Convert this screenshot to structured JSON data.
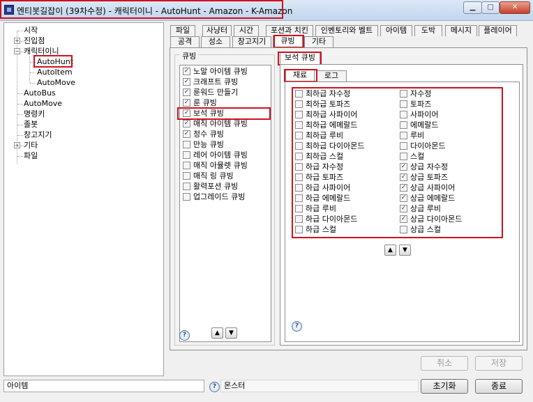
{
  "window": {
    "title": "엔티봇길잡이 (39차수정) - 캐릭터이니 - AutoHunt - Amazon - K-Amazon",
    "min_glyph": "▁",
    "max_glyph": "□",
    "close_glyph": "✕"
  },
  "tree": {
    "items": [
      {
        "label": "시작",
        "expander": ""
      },
      {
        "label": "진입점",
        "expander": "+"
      },
      {
        "label": "캐릭터이니",
        "expander": "−"
      },
      {
        "label": "AutoHunt",
        "expander": ""
      },
      {
        "label": "AutoItem",
        "expander": ""
      },
      {
        "label": "AutoMove",
        "expander": ""
      },
      {
        "label": "AutoBus",
        "expander": ""
      },
      {
        "label": "AutoMove",
        "expander": ""
      },
      {
        "label": "명령키",
        "expander": ""
      },
      {
        "label": "졸봇",
        "expander": ""
      },
      {
        "label": "창고지기",
        "expander": ""
      },
      {
        "label": "기타",
        "expander": "+"
      },
      {
        "label": "파일",
        "expander": ""
      }
    ]
  },
  "tabs": {
    "row1": [
      "파일",
      "사냥터",
      "시간",
      "포션과 치킨",
      "인벤토리와 벨트",
      "아이템",
      "도박",
      "메시지",
      "플레이어"
    ],
    "row2": [
      "공격",
      "성소",
      "창고지기",
      "큐빙",
      "기타"
    ],
    "active": "큐빙"
  },
  "cubing": {
    "group_title": "큐빙",
    "items": [
      {
        "label": "노말 아이템 큐빙",
        "checked": true
      },
      {
        "label": "크래프트 큐빙",
        "checked": true
      },
      {
        "label": "룬워드 만들기",
        "checked": true
      },
      {
        "label": "룬 큐빙",
        "checked": true
      },
      {
        "label": "보석 큐빙",
        "checked": true
      },
      {
        "label": "매직 아이템 큐빙",
        "checked": true
      },
      {
        "label": "정수 큐빙",
        "checked": true
      },
      {
        "label": "만능 큐빙",
        "checked": false
      },
      {
        "label": "레어 아이템 큐빙",
        "checked": false
      },
      {
        "label": "매직 아뮬렛 큐빙",
        "checked": false
      },
      {
        "label": "매직 링 큐빙",
        "checked": false
      },
      {
        "label": "활력포션 큐빙",
        "checked": false
      },
      {
        "label": "업그레이드 큐빙",
        "checked": false
      }
    ]
  },
  "gem_tab": {
    "title": "보석 큐빙",
    "subtabs": [
      "재료",
      "로그"
    ],
    "active_subtab": "재료",
    "col1": [
      {
        "label": "최하급 자수정",
        "checked": false
      },
      {
        "label": "최하급 토파즈",
        "checked": false
      },
      {
        "label": "최하급 사파이어",
        "checked": false
      },
      {
        "label": "최하급 에메랄드",
        "checked": false
      },
      {
        "label": "최하급 루비",
        "checked": false
      },
      {
        "label": "최하급 다이아몬드",
        "checked": false
      },
      {
        "label": "최하급 스컬",
        "checked": false
      },
      {
        "label": "하급 자수정",
        "checked": false
      },
      {
        "label": "하급 토파즈",
        "checked": false
      },
      {
        "label": "하급 사파이어",
        "checked": false
      },
      {
        "label": "하급 에메랄드",
        "checked": false
      },
      {
        "label": "하급 루비",
        "checked": false
      },
      {
        "label": "하급 다이아몬드",
        "checked": false
      },
      {
        "label": "하급 스컬",
        "checked": false
      }
    ],
    "col2": [
      {
        "label": "자수정",
        "checked": false
      },
      {
        "label": "토파즈",
        "checked": false
      },
      {
        "label": "사파이어",
        "checked": false
      },
      {
        "label": "에메랄드",
        "checked": false
      },
      {
        "label": "루비",
        "checked": false
      },
      {
        "label": "다이아몬드",
        "checked": false
      },
      {
        "label": "스컬",
        "checked": false
      },
      {
        "label": "상급 자수정",
        "checked": true
      },
      {
        "label": "상급 토파즈",
        "checked": true
      },
      {
        "label": "상급 사파이어",
        "checked": true
      },
      {
        "label": "상급 에메랄드",
        "checked": true
      },
      {
        "label": "상급 루비",
        "checked": true
      },
      {
        "label": "상급 다이아몬드",
        "checked": true
      },
      {
        "label": "상급 스컬",
        "checked": false
      }
    ]
  },
  "glyphs": {
    "up": "▲",
    "down": "▼",
    "help": "?",
    "check": "✓"
  },
  "buttons": {
    "cancel": "취소",
    "save": "저장",
    "reset": "초기화",
    "exit": "종료"
  },
  "status": {
    "left_field": "아이템",
    "right_field": "몬스터"
  },
  "colors": {
    "highlight": "#d0101c",
    "title_bar": "#c9d9ef"
  }
}
